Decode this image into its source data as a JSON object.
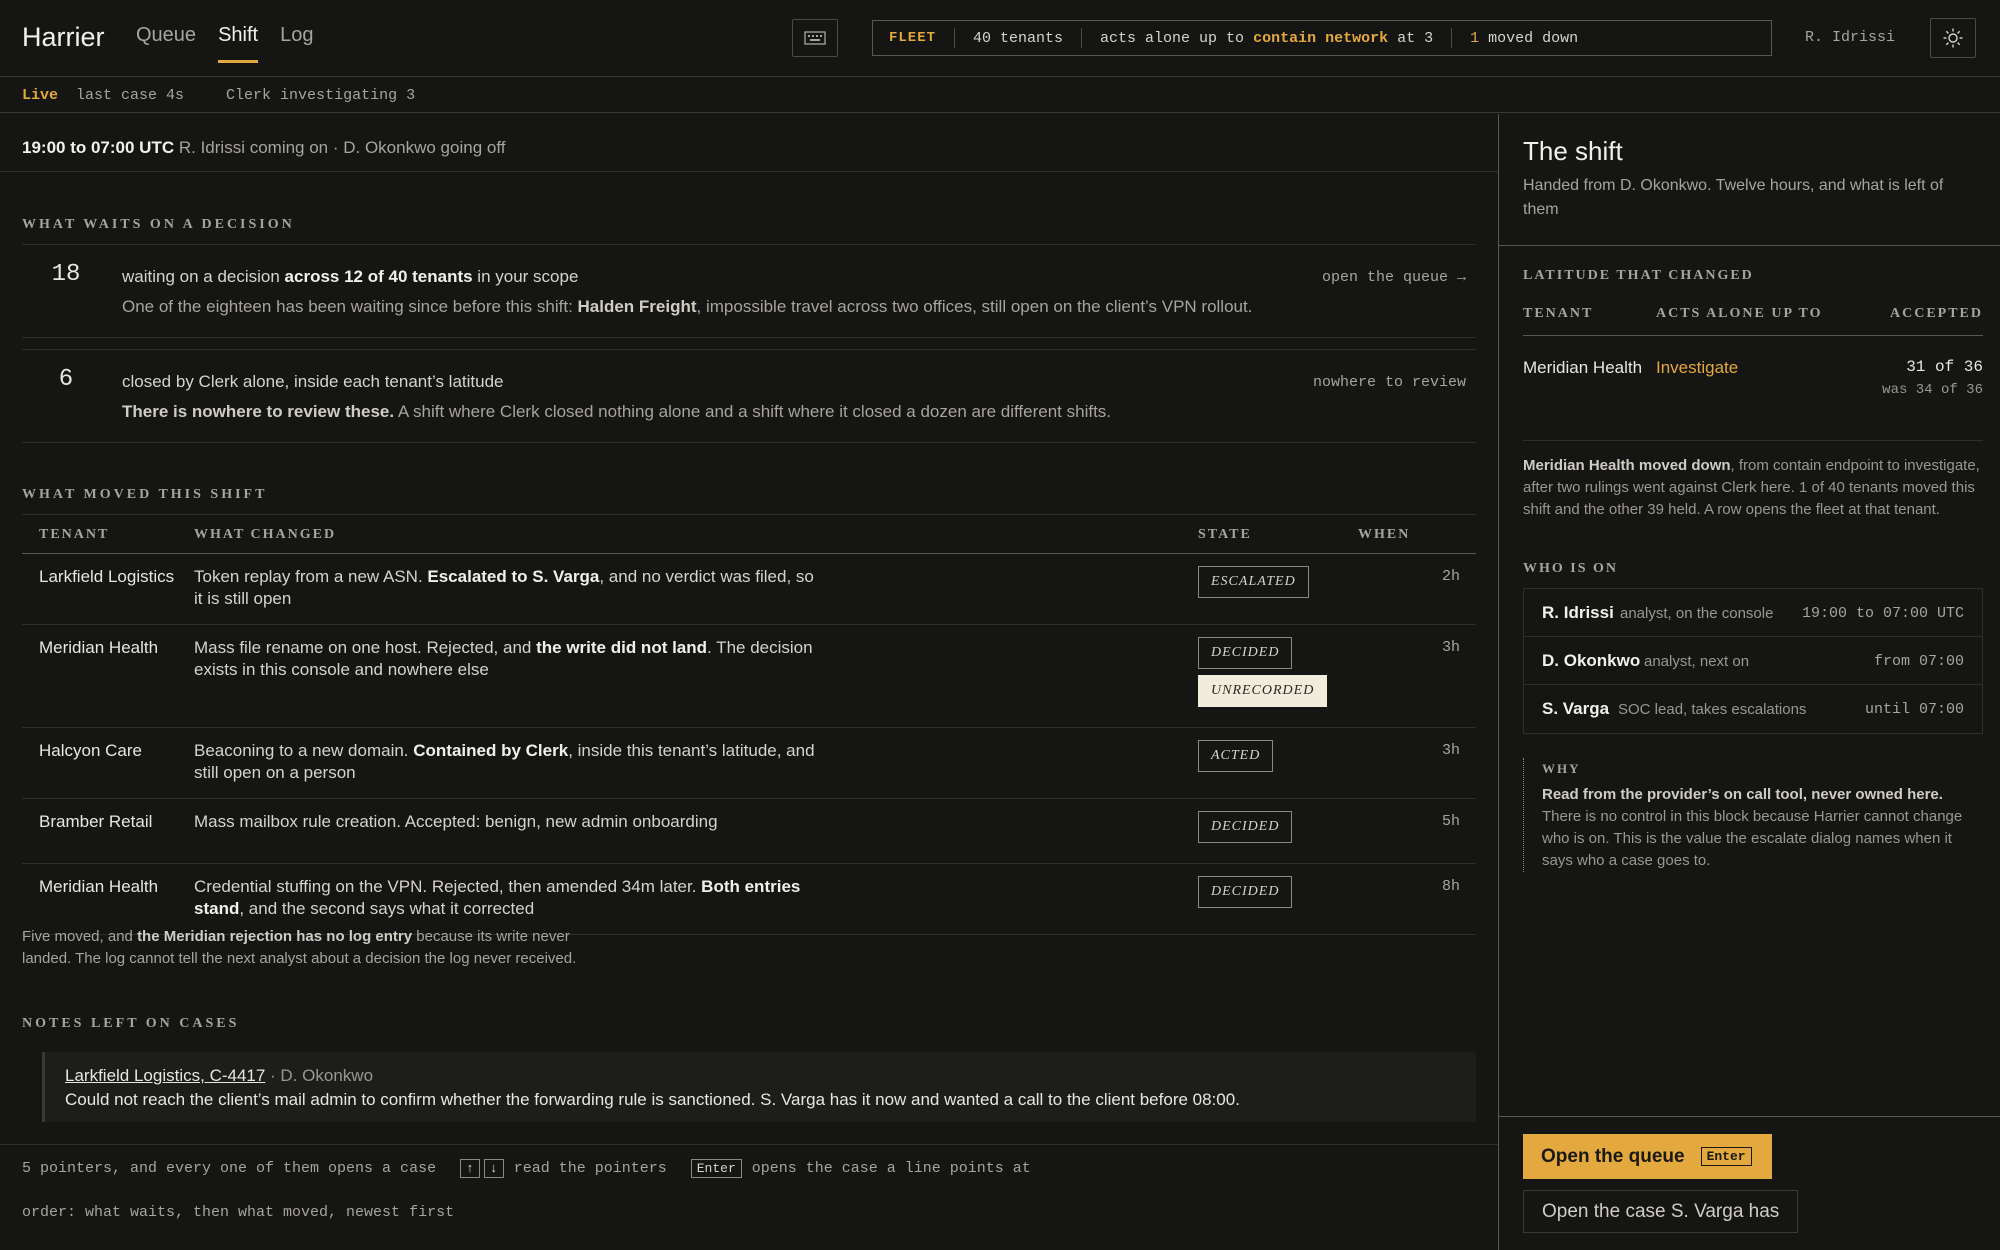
{
  "app": {
    "name": "Harrier",
    "user": "R. Idrissi"
  },
  "nav": [
    "Queue",
    "Shift",
    "Log"
  ],
  "nav_active": "Shift",
  "fleet": {
    "tag": "FLEET",
    "tenants": "40 tenants",
    "acts_pre": "acts alone up to",
    "acts_level": "contain network",
    "acts_post": "at 3",
    "moved_count": "1",
    "moved_text": "moved down"
  },
  "live": {
    "label": "Live",
    "last_case": "last case 4s",
    "clerk": "Clerk investigating 3"
  },
  "shift": {
    "time": "19:00 to 07:00 UTC",
    "people": "R. Idrissi coming on · D. Okonkwo going off"
  },
  "waits": {
    "heading": "WHAT WAITS ON A DECISION",
    "items": [
      {
        "count": "18",
        "line_pre": "waiting on a decision ",
        "line_bold": "across 12 of 40 tenants",
        "line_post": " in your scope",
        "detail_pre": "One of the eighteen has been waiting since before this shift: ",
        "detail_bold": "Halden Freight",
        "detail_post": ", impossible travel across two offices, still open on the client’s VPN rollout.",
        "link": "open the queue →"
      },
      {
        "count": "6",
        "line_pre": "closed by Clerk alone, inside each tenant’s latitude",
        "line_bold": "",
        "line_post": "",
        "detail_pre": "",
        "detail_bold": "There is nowhere to review these.",
        "detail_post": " A shift where Clerk closed nothing alone and a shift where it closed a dozen are different shifts.",
        "link": "nowhere to review"
      }
    ]
  },
  "moved": {
    "heading": "WHAT MOVED THIS SHIFT",
    "columns": [
      "TENANT",
      "WHAT CHANGED",
      "STATE",
      "WHEN"
    ],
    "rows": [
      {
        "tenant": "Larkfield Logistics",
        "pre": "Token replay from a new ASN. ",
        "bold": "Escalated to S. Varga",
        "post": ", and no verdict was filed, so it is still open",
        "states": [
          "ESCALATED"
        ],
        "when": "2h"
      },
      {
        "tenant": "Meridian Health",
        "pre": "Mass file rename on one host. Rejected, and ",
        "bold": "the write did not land",
        "post": ". The decision exists in this console and nowhere else",
        "states": [
          "DECIDED",
          "UNRECORDED"
        ],
        "when": "3h"
      },
      {
        "tenant": "Halcyon Care",
        "pre": "Beaconing to a new domain. ",
        "bold": "Contained by Clerk",
        "post": ", inside this tenant’s latitude, and still open on a person",
        "states": [
          "ACTED"
        ],
        "when": "3h"
      },
      {
        "tenant": "Bramber Retail",
        "pre": "Mass mailbox rule creation. Accepted: benign, new admin onboarding",
        "bold": "",
        "post": "",
        "states": [
          "DECIDED"
        ],
        "when": "5h"
      },
      {
        "tenant": "Meridian Health",
        "pre": "Credential stuffing on the VPN. Rejected, then amended 34m later. ",
        "bold": "Both entries stand",
        "post": ", and the second says what it corrected",
        "states": [
          "DECIDED"
        ],
        "when": "8h"
      }
    ],
    "summary_pre": "Five moved, and ",
    "summary_bold": "the Meridian rejection has no log entry",
    "summary_post": " because its write never landed. The log cannot tell the next analyst about a decision the log never received."
  },
  "notes": {
    "heading": "NOTES LEFT ON CASES",
    "items": [
      {
        "case": "Larkfield Logistics, C-4417",
        "author": " · D. Okonkwo",
        "text": "Could not reach the client’s mail admin to confirm whether the forwarding rule is sanctioned. S. Varga has it now and wanted a call to the client before 08:00."
      }
    ]
  },
  "footer": {
    "pointers": "5 pointers, and every one of them opens a case",
    "key_up": "↑",
    "key_down": "↓",
    "read": "read the pointers",
    "key_enter": "Enter",
    "opens": "opens the case a line points at",
    "order": "order: what waits, then what moved, newest first"
  },
  "side": {
    "title": "The shift",
    "subtitle": "Handed from D. Okonkwo. Twelve hours, and what is left of them",
    "latitude_heading": "LATITUDE THAT CHANGED",
    "lat_columns": [
      "TENANT",
      "ACTS ALONE UP TO",
      "ACCEPTED"
    ],
    "lat_row": {
      "tenant": "Meridian Health",
      "level": "Investigate",
      "accepted": "31 of 36",
      "was": "was 34 of 36"
    },
    "lat_note_bold": "Meridian Health moved down",
    "lat_note_rest": ", from contain endpoint to investigate, after two rulings went against Clerk here. 1 of 40 tenants moved this shift and the other 39 held. A row opens the fleet at that tenant.",
    "who_heading": "WHO IS ON",
    "who": [
      {
        "name": "R. Idrissi",
        "role": "analyst, on the console",
        "time": "19:00 to 07:00 UTC"
      },
      {
        "name": "D. Okonkwo",
        "role": "analyst, next on",
        "time": "from 07:00"
      },
      {
        "name": "S. Varga",
        "role": "SOC lead, takes escalations",
        "time": "until 07:00"
      }
    ],
    "why_heading": "WHY",
    "why_bold": "Read from the provider’s on call tool, never owned here.",
    "why_text": "There is no control in this block because Harrier cannot change who is on. This is the value the escalate dialog names when it says who a case goes to.",
    "primary_button": "Open the queue",
    "primary_key": "Enter",
    "secondary_button": "Open the case S. Varga has"
  }
}
